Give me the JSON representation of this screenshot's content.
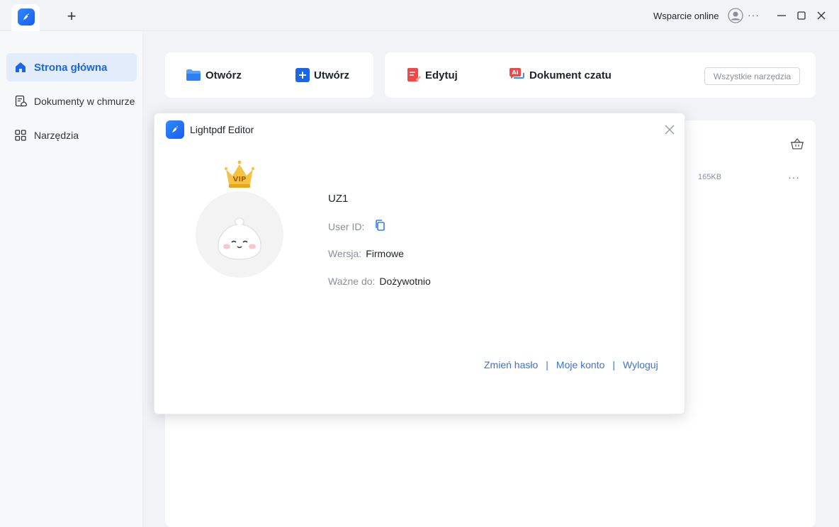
{
  "titlebar": {
    "new_tab": "+",
    "support": "Wsparcie online",
    "more": "···"
  },
  "sidebar": {
    "items": [
      {
        "label": "Strona główna",
        "icon": "home-icon",
        "active": true
      },
      {
        "label": "Dokumenty w chmurze",
        "icon": "cloud-documents-icon",
        "active": false
      },
      {
        "label": "Narzędzia",
        "icon": "grid-icon",
        "active": false
      }
    ]
  },
  "toolbar": {
    "open": "Otwórz",
    "create": "Utwórz",
    "edit": "Edytuj",
    "chat": "Dokument czatu",
    "all_tools": "Wszystkie narzędzia"
  },
  "list": {
    "file_size": "165KB",
    "more": "···"
  },
  "modal": {
    "title": "Lightpdf Editor",
    "vip_badge": "VIP",
    "username": "UZ1",
    "user_id_label": "User ID:",
    "version_label": "Wersja:",
    "version_value": "Firmowe",
    "valid_label": "Ważne do:",
    "valid_value": "Dożywotnio",
    "links": {
      "change_password": "Zmień hasło",
      "my_account": "Moje konto",
      "logout": "Wyloguj",
      "separator": "|"
    }
  },
  "colors": {
    "accent": "#1a66e8",
    "link": "#3b73d9",
    "edit_red": "#f04848",
    "vip_gold": "#f5c242"
  }
}
